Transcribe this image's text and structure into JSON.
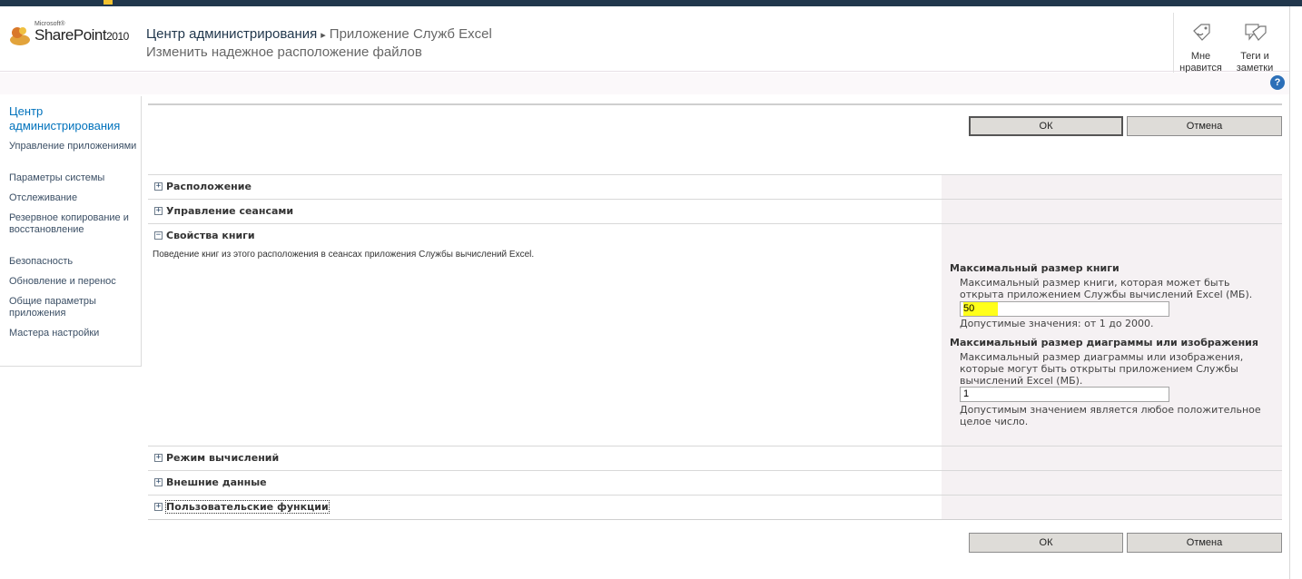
{
  "header": {
    "logo": {
      "microsoft": "Microsoft®",
      "product": "SharePoint",
      "year": "2010"
    },
    "breadcrumb": {
      "root": "Центр администрирования",
      "separator": "▸",
      "current": "Приложение Служб Excel"
    },
    "page_title": "Изменить надежное расположение файлов",
    "social": {
      "like_label": "Мне нравится",
      "tags_label": "Теги и заметки"
    },
    "help_icon": "?"
  },
  "leftnav": {
    "heading": "Центр администрирования",
    "items": [
      "Управление приложениями",
      "Параметры системы",
      "Отслеживание",
      "Резервное копирование и восстановление",
      "Безопасность",
      "Обновление и перенос",
      "Общие параметры приложения",
      "Мастера настройки"
    ]
  },
  "buttons": {
    "ok": "ОК",
    "cancel": "Отмена"
  },
  "sections": {
    "location": {
      "title": "Расположение",
      "state": "+"
    },
    "sessions": {
      "title": "Управление сеансами",
      "state": "+"
    },
    "book_props": {
      "title": "Свойства книги",
      "state": "−"
    },
    "calc_mode": {
      "title": "Режим вычислений",
      "state": "+"
    },
    "external": {
      "title": "Внешние данные",
      "state": "+"
    },
    "udf": {
      "title": "Пользовательские функции",
      "state": "+"
    }
  },
  "book": {
    "description": "Поведение книг из этого расположения в сеансах приложения Службы вычислений Excel.",
    "max_size": {
      "label": "Максимальный размер книги",
      "description": "Максимальный размер книги, которая может быть открыта приложением Службы вычислений Excel (МБ).",
      "value": "50",
      "hint": "Допустимые значения: от 1 до 2000."
    },
    "max_chart": {
      "label": "Максимальный размер диаграммы или изображения",
      "description": "Максимальный размер диаграммы или изображения, которые могут быть открыты приложением Службы вычислений Excel (МБ).",
      "value": "1",
      "hint": "Допустимым значением является любое положительное целое число."
    }
  },
  "colors": {
    "accent": "#0072bc",
    "topbar": "#21374c",
    "highlight": "#ffff1a",
    "panel": "#f5f1f3"
  }
}
